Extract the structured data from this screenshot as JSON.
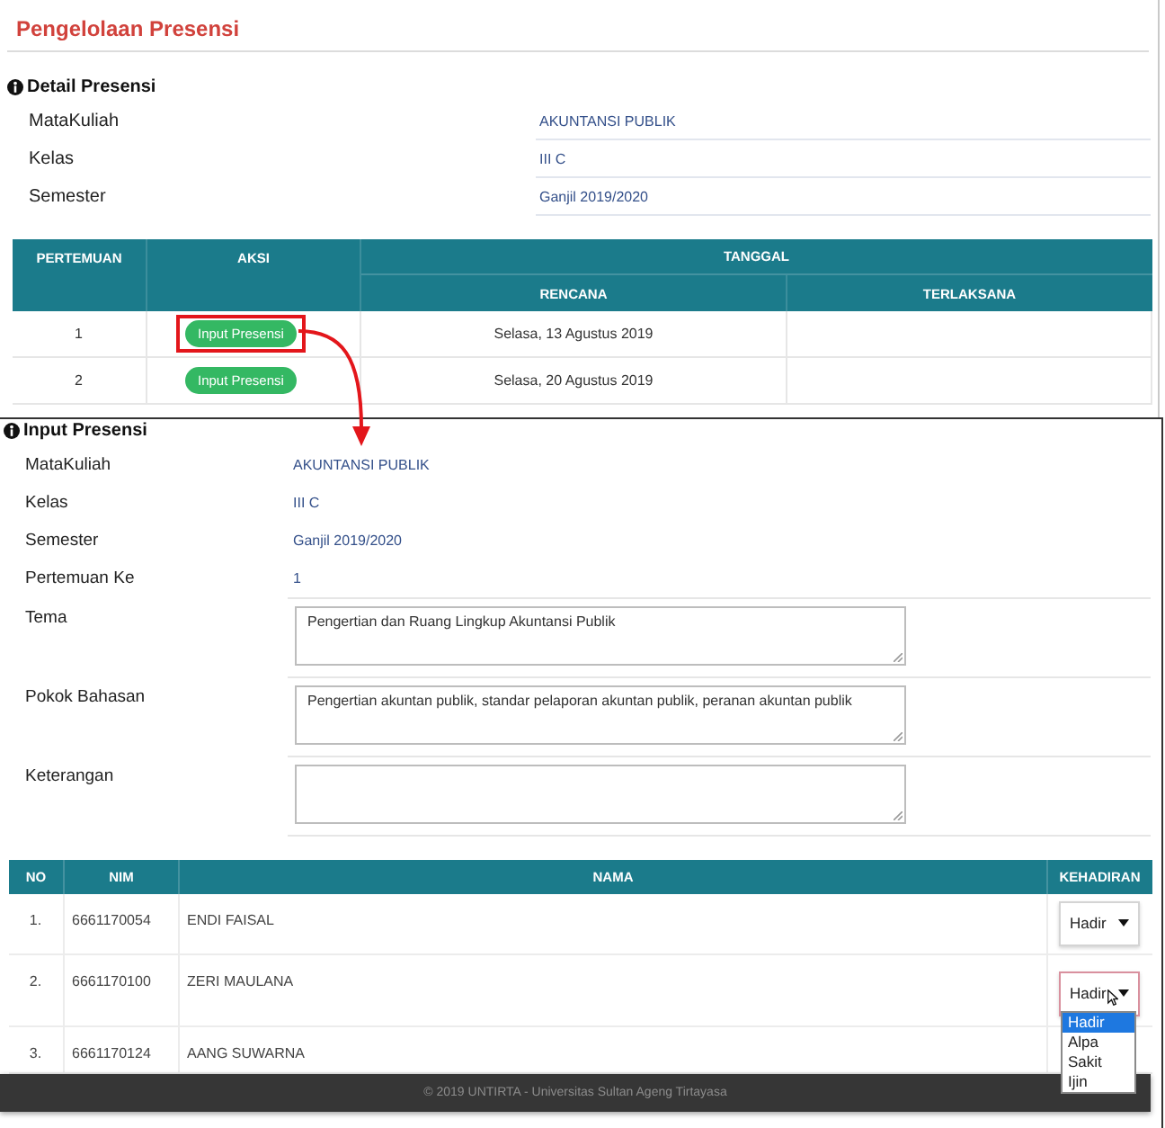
{
  "page": {
    "title": "Pengelolaan Presensi"
  },
  "detail": {
    "heading": "Detail Presensi",
    "fields": [
      {
        "label": "MataKuliah",
        "value": "AKUNTANSI PUBLIK"
      },
      {
        "label": "Kelas",
        "value": "III C"
      },
      {
        "label": "Semester",
        "value": "Ganjil 2019/2020"
      }
    ]
  },
  "schedule_table": {
    "columns": {
      "pertemuan": "PERTEMUAN",
      "aksi": "AKSI",
      "tanggal": "TANGGAL",
      "rencana": "RENCANA",
      "terlaksana": "TERLAKSANA"
    },
    "rows": [
      {
        "pertemuan": "1",
        "action": "Input Presensi",
        "highlighted": true,
        "rencana": "Selasa, 13 Agustus 2019"
      },
      {
        "pertemuan": "2",
        "action": "Input Presensi",
        "highlighted": false,
        "rencana": "Selasa, 20 Agustus 2019"
      }
    ]
  },
  "input_form": {
    "heading": "Input Presensi",
    "info_fields": [
      {
        "label": "MataKuliah",
        "value": "AKUNTANSI PUBLIK"
      },
      {
        "label": "Kelas",
        "value": "III C"
      },
      {
        "label": "Semester",
        "value": "Ganjil 2019/2020"
      },
      {
        "label": "Pertemuan Ke",
        "value": "1"
      }
    ],
    "text_fields": [
      {
        "label": "Tema",
        "value": "Pengertian dan Ruang Lingkup Akuntansi Publik"
      },
      {
        "label": "Pokok Bahasan",
        "value": "Pengertian akuntan publik, standar pelaporan akuntan publik, peranan akuntan publik"
      },
      {
        "label": "Keterangan"
      }
    ]
  },
  "students_table": {
    "columns": [
      "NO",
      "NIM",
      "NAMA",
      "KEHADIRAN"
    ],
    "rows": [
      {
        "no": "1.",
        "nim": "6661170054",
        "nama": "ENDI FAISAL",
        "kehadiran": "Hadir",
        "expanded": false
      },
      {
        "no": "2.",
        "nim": "6661170100",
        "nama": "ZERI MAULANA",
        "kehadiran": "Hadir",
        "expanded": true,
        "options": [
          {
            "label": "Hadir",
            "selected": true
          },
          {
            "label": "Alpa",
            "selected": false
          },
          {
            "label": "Sakit",
            "selected": false
          },
          {
            "label": "Ijin",
            "selected": false
          }
        ]
      },
      {
        "no": "3.",
        "nim": "6661170124",
        "nama": "AANG SUWARNA"
      }
    ]
  },
  "footer": {
    "text": "© 2019 UNTIRTA - Universitas Sultan Ageng Tirtayasa"
  }
}
